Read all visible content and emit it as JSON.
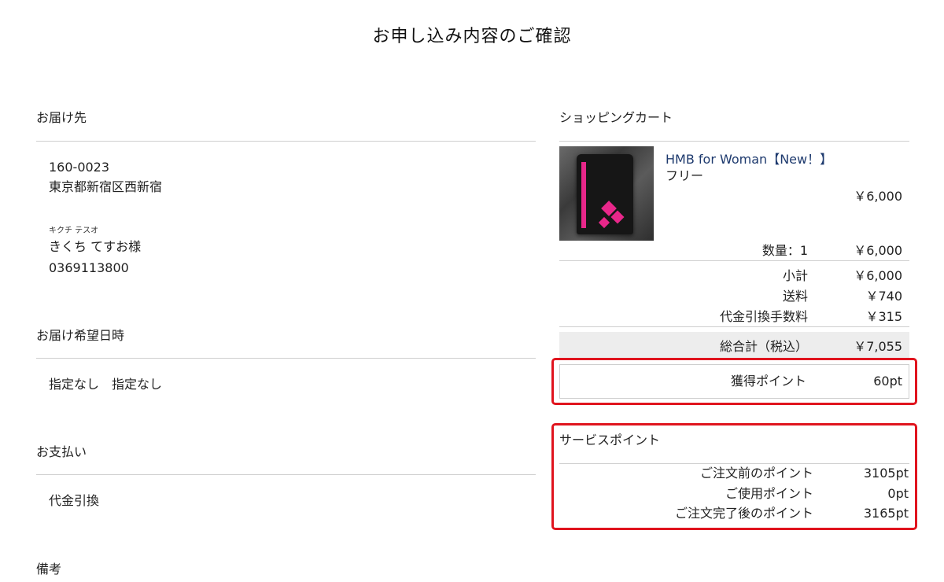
{
  "page_title": "お申し込み内容のご確認",
  "delivery": {
    "heading": "お届け先",
    "postal_code": "160-0023",
    "address": "東京都新宿区西新宿",
    "name_kana": "キクチ テスオ",
    "name": "きくち てすお様",
    "phone": "0369113800"
  },
  "delivery_time": {
    "heading": "お届け希望日時",
    "value": "指定なし　指定なし"
  },
  "payment": {
    "heading": "お支払い",
    "value": "代金引換"
  },
  "notes": {
    "heading": "備考"
  },
  "cart": {
    "heading": "ショッピングカート",
    "product": {
      "name": "HMB for Woman【New！】",
      "variant": "フリー",
      "price": "￥6,000",
      "quantity_label": "数量：1",
      "line_total": "￥6,000"
    },
    "subtotal_label": "小計",
    "subtotal": "￥6,000",
    "shipping_label": "送料",
    "shipping": "￥740",
    "cod_fee_label": "代金引換手数料",
    "cod_fee": "￥315",
    "grand_total_label": "総合計（税込）",
    "grand_total": "￥7,055",
    "earned_points_label": "獲得ポイント",
    "earned_points": "60pt"
  },
  "service_points": {
    "heading": "サービスポイント",
    "before_label": "ご注文前のポイント",
    "before": "3105pt",
    "used_label": "ご使用ポイント",
    "used": "0pt",
    "after_label": "ご注文完了後のポイント",
    "after": "3165pt"
  },
  "colors": {
    "highlight_border": "#e0141e",
    "product_link": "#1e3a6e",
    "total_band": "#ededed"
  }
}
